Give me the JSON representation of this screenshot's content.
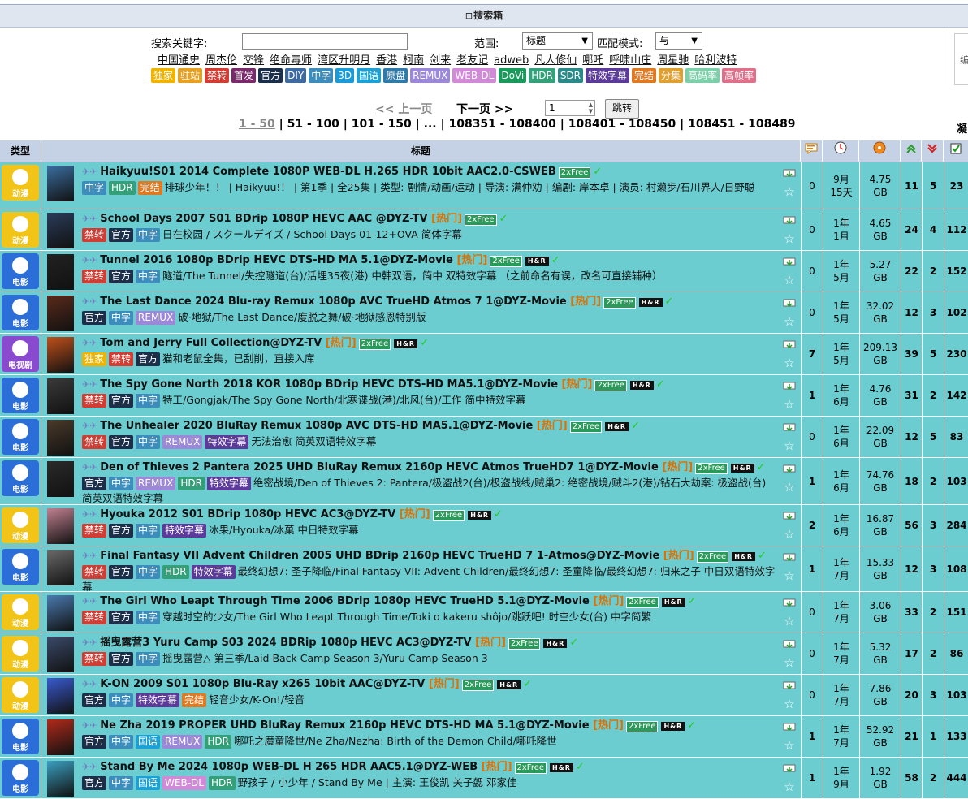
{
  "search": {
    "header": "搜索箱",
    "keyword_label": "搜索关键字:",
    "keyword_value": "",
    "scope_label": "范围:",
    "scope_value": "标题",
    "mode_label": "匹配模式:",
    "mode_value": "与",
    "quick_links": [
      "中国通史",
      "周杰伦",
      "交锋",
      "绝命毒师",
      "湾区升明月",
      "香港",
      "柯南",
      "剑来",
      "老友记",
      "adweb",
      "凡人修仙",
      "哪吒",
      "呼啸山庄",
      "周星驰",
      "哈利波特"
    ],
    "filter_tags": [
      {
        "label": "独家",
        "color": "#f0b400"
      },
      {
        "label": "驻站",
        "color": "#e8a020"
      },
      {
        "label": "禁转",
        "color": "#d23c32"
      },
      {
        "label": "首发",
        "color": "#7a2a6a"
      },
      {
        "label": "官方",
        "color": "#1c2f4a"
      },
      {
        "label": "DIY",
        "color": "#3d6aa0"
      },
      {
        "label": "中字",
        "color": "#3c8dbc"
      },
      {
        "label": "3D",
        "color": "#1a9ad6"
      },
      {
        "label": "国语",
        "color": "#1aa2d8"
      },
      {
        "label": "原盘",
        "color": "#2f7aa8"
      },
      {
        "label": "REMUX",
        "color": "#9c88d8"
      },
      {
        "label": "WEB-DL",
        "color": "#d28ad8"
      },
      {
        "label": "DoVi",
        "color": "#1a9a5a"
      },
      {
        "label": "HDR",
        "color": "#34a07a"
      },
      {
        "label": "SDR",
        "color": "#2a8a8a"
      },
      {
        "label": "特效字幕",
        "color": "#5b3a9a"
      },
      {
        "label": "完结",
        "color": "#e07a22"
      },
      {
        "label": "分集",
        "color": "#e0a030"
      },
      {
        "label": "高码率",
        "color": "#7ccfa8"
      },
      {
        "label": "高帧率",
        "color": "#e0708a"
      }
    ],
    "side_text": "编"
  },
  "pager": {
    "prev": "<< 上一页",
    "next": "下一页 >>",
    "page_value": "1",
    "jump": "跳转",
    "current": "1 - 50",
    "ranges_text": " | 51 - 100 | 101 - 150 | ... | 108351 - 108400 | 108401 - 108450 | 108451 - 108489",
    "side": "凝"
  },
  "table": {
    "col_type": "类型",
    "col_title": "标题",
    "icons": {
      "comments": "comment-icon",
      "time": "clock-icon",
      "size": "disc-icon",
      "seeders": "up-arrows-icon",
      "leechers": "down-arrows-icon",
      "completed": "check-icon"
    },
    "rows": [
      {
        "cat": "动漫",
        "catcolor": "#f2c418",
        "poster": "#3a6ea0",
        "title": "Haikyuu!S01 2014 Complete 1080P WEB-DL H.265 HDR 10bit AAC2.0-CSWEB",
        "hot": "",
        "hr": false,
        "tags": [
          "中字",
          "HDR",
          "完结"
        ],
        "sub": "排球少年！！ | Haikyuu!！ | 第1季 | 全25集 | 类型: 剧情/动画/运动 | 导演: 满仲劝 | 编剧: 岸本卓 | 演员: 村濑步/石川界人/日野聪",
        "comments": "0",
        "time1": "9月",
        "time2": "15天",
        "size1": "4.75",
        "size2": "GB",
        "seed": "11",
        "leech": "5",
        "done": "23",
        "h": 58,
        "boldc": false
      },
      {
        "cat": "动漫",
        "catcolor": "#f2c418",
        "poster": "#2a3c5a",
        "title": "School Days 2007 S01 BDrip 1080P HEVC AAC @DYZ-TV",
        "hot": "[热门]",
        "hr": false,
        "tags": [
          "禁转",
          "官方",
          "中字"
        ],
        "sub": "日在校园 / スクールデイズ / School Days 01-12+OVA 简体字幕",
        "comments": "0",
        "time1": "1年",
        "time2": "1月",
        "size1": "4.65",
        "size2": "GB",
        "seed": "24",
        "leech": "4",
        "done": "112",
        "h": 51,
        "boldc": false
      },
      {
        "cat": "电影",
        "catcolor": "#2b6ed8",
        "poster": "#222",
        "title": "Tunnel 2016 1080p BDrip HEVC DTS-HD MA 5.1@DYZ-Movie",
        "hot": "[热门]",
        "hr": true,
        "tags": [
          "禁转",
          "官方",
          "中字"
        ],
        "sub": "隧道/The Tunnel/失控隧道(台)/活埋35夜(港) 中韩双语，简中 双特效字幕 （之前命名有误，改名可直接辅种）",
        "comments": "0",
        "time1": "1年",
        "time2": "5月",
        "size1": "5.27",
        "size2": "GB",
        "seed": "22",
        "leech": "2",
        "done": "152",
        "h": 51,
        "boldc": false
      },
      {
        "cat": "电影",
        "catcolor": "#2b6ed8",
        "poster": "#5a2a1a",
        "title": "The Last Dance 2024 Blu-ray Remux 1080p AVC TrueHD Atmos 7 1@DYZ-Movie",
        "hot": "[热门]",
        "hr": true,
        "tags": [
          "官方",
          "中字",
          "REMUX"
        ],
        "sub": "破·地狱/The Last Dance/度脱之舞/破·地狱感恩特别版",
        "comments": "0",
        "time1": "1年",
        "time2": "5月",
        "size1": "32.02",
        "size2": "GB",
        "seed": "12",
        "leech": "3",
        "done": "102",
        "h": 51,
        "boldc": false
      },
      {
        "cat": "电视剧",
        "catcolor": "#8a4ad0",
        "poster": "#c0501a",
        "title": "Tom and Jerry Full Collection@DYZ-TV",
        "hot": "[热门]",
        "hr": true,
        "tags": [
          "独家",
          "禁转",
          "官方"
        ],
        "sub": "猫和老鼠全集，已刮削，直接入库",
        "comments": "7",
        "time1": "1年",
        "time2": "5月",
        "size1": "209.13",
        "size2": "GB",
        "seed": "39",
        "leech": "5",
        "done": "230",
        "h": 51,
        "boldc": true
      },
      {
        "cat": "电影",
        "catcolor": "#2b6ed8",
        "poster": "#3a3a3a",
        "title": "The Spy Gone North 2018 KOR 1080p BDrip HEVC DTS-HD MA5.1@DYZ-Movie",
        "hot": "[热门]",
        "hr": true,
        "tags": [
          "禁转",
          "官方",
          "中字"
        ],
        "sub": "特工/Gongjak/The Spy Gone North/北寒谍战(港)/北风(台)/工作 简中特效字幕",
        "comments": "1",
        "time1": "1年",
        "time2": "6月",
        "size1": "4.76",
        "size2": "GB",
        "seed": "31",
        "leech": "2",
        "done": "142",
        "h": 51,
        "boldc": true
      },
      {
        "cat": "电影",
        "catcolor": "#2b6ed8",
        "poster": "#4a3a2a",
        "title": "The Unhealer 2020 BluRay Remux 1080p AVC DTS-HD MA5.1@DYZ-Movie",
        "hot": "[热门]",
        "hr": true,
        "tags": [
          "禁转",
          "官方",
          "中字",
          "REMUX",
          "特效字幕"
        ],
        "sub": "无法治愈 简英双语特效字幕",
        "comments": "0",
        "time1": "1年",
        "time2": "6月",
        "size1": "22.09",
        "size2": "GB",
        "seed": "12",
        "leech": "5",
        "done": "83",
        "h": 51,
        "boldc": false
      },
      {
        "cat": "电影",
        "catcolor": "#2b6ed8",
        "poster": "#2a2a2a",
        "title": "Den of Thieves 2 Pantera 2025 UHD BluRay Remux 2160p HEVC Atmos TrueHD7 1@DYZ-Movie",
        "hot": "[热门]",
        "hr": true,
        "tags": [
          "官方",
          "中字",
          "REMUX",
          "HDR",
          "特效字幕"
        ],
        "sub": "绝密战境/Den of Thieves 2: Pantera/极盗战2(台)/极盗战线/贼巢2: 绝密战境/贼斗2(港)/钻石大劫案: 极盗战(台) 简英双语特效字幕",
        "comments": "1",
        "time1": "1年",
        "time2": "6月",
        "size1": "74.76",
        "size2": "GB",
        "seed": "18",
        "leech": "2",
        "done": "103",
        "h": 58,
        "boldc": true
      },
      {
        "cat": "动漫",
        "catcolor": "#f2c418",
        "poster": "#c08090",
        "title": "Hyouka 2012 S01 BDrip 1080p HEVC AC3@DYZ-TV",
        "hot": "[热门]",
        "hr": true,
        "tags": [
          "禁转",
          "官方",
          "中字",
          "特效字幕"
        ],
        "sub": "冰果/Hyouka/冰菓 中日特效字幕",
        "comments": "2",
        "time1": "1年",
        "time2": "6月",
        "size1": "16.87",
        "size2": "GB",
        "seed": "56",
        "leech": "3",
        "done": "284",
        "h": 51,
        "boldc": true
      },
      {
        "cat": "电影",
        "catcolor": "#2b6ed8",
        "poster": "#6a6a6a",
        "title": "Final Fantasy VII Advent Children 2005 UHD BDrip 2160p HEVC TrueHD 7 1-Atmos@DYZ-Movie",
        "hot": "[热门]",
        "hr": true,
        "tags": [
          "禁转",
          "官方",
          "中字",
          "HDR",
          "特效字幕"
        ],
        "sub": "最终幻想7: 圣子降临/Final Fantasy VII: Advent Children/最终幻想7: 圣童降临/最终幻想7: 归来之子 中日双语特效字幕",
        "comments": "1",
        "time1": "1年",
        "time2": "7月",
        "size1": "15.33",
        "size2": "GB",
        "seed": "12",
        "leech": "3",
        "done": "108",
        "h": 56,
        "boldc": true
      },
      {
        "cat": "动漫",
        "catcolor": "#f2c418",
        "poster": "#4a7ab0",
        "title": "The Girl Who Leapt Through Time 2006 BDrip 1080p HEVC TrueHD 5.1@DYZ-Movie",
        "hot": "[热门]",
        "hr": true,
        "tags": [
          "禁转",
          "官方",
          "中字"
        ],
        "sub": "穿越时空的少女/The Girl Who Leapt Through Time/Toki o kakeru shôjo/跳跃吧! 时空少女(台) 中字简繁",
        "comments": "0",
        "time1": "1年",
        "time2": "7月",
        "size1": "3.06",
        "size2": "GB",
        "seed": "33",
        "leech": "2",
        "done": "151",
        "h": 51,
        "boldc": false
      },
      {
        "cat": "动漫",
        "catcolor": "#f2c418",
        "poster": "#3a4a6a",
        "title": "摇曳露营3 Yuru Camp S03 2024 BDRip 1080p HEVC AC3@DYZ-TV",
        "hot": "[热门]",
        "hr": true,
        "tags": [
          "禁转",
          "官方",
          "中字"
        ],
        "sub": "摇曳露营△ 第三季/Laid-Back Camp Season 3/Yuru Camp Season 3",
        "comments": "0",
        "time1": "1年",
        "time2": "7月",
        "size1": "5.32",
        "size2": "GB",
        "seed": "17",
        "leech": "2",
        "done": "86",
        "h": 51,
        "boldc": false
      },
      {
        "cat": "动漫",
        "catcolor": "#f2c418",
        "poster": "#3a5ad0",
        "title": "K-ON 2009 S01 1080p Blu-Ray x265 10bit AAC@DYZ-TV",
        "hot": "[热门]",
        "hr": true,
        "tags": [
          "官方",
          "中字",
          "特效字幕",
          "完结"
        ],
        "sub": "轻音少女/K-On!/轻音",
        "comments": "0",
        "time1": "1年",
        "time2": "7月",
        "size1": "7.86",
        "size2": "GB",
        "seed": "20",
        "leech": "3",
        "done": "103",
        "h": 51,
        "boldc": false
      },
      {
        "cat": "电影",
        "catcolor": "#2b6ed8",
        "poster": "#b02a1a",
        "title": "Ne Zha 2019 PROPER UHD BluRay Remux 2160p HEVC DTS-HD MA 5.1@DYZ-Movie",
        "hot": "[热门]",
        "hr": true,
        "tags": [
          "官方",
          "中字",
          "国语",
          "REMUX",
          "HDR"
        ],
        "sub": "哪吒之魔童降世/Ne Zha/Nezha: Birth of the Demon Child/哪吒降世",
        "comments": "1",
        "time1": "1年",
        "time2": "7月",
        "size1": "52.92",
        "size2": "GB",
        "seed": "21",
        "leech": "1",
        "done": "133",
        "h": 51,
        "boldc": true
      },
      {
        "cat": "电影",
        "catcolor": "#2b6ed8",
        "poster": "#3aa0c0",
        "title": "Stand By Me 2024 1080p WEB-DL H 265 HDR AAC5.1@DYZ-WEB",
        "hot": "[热门]",
        "hr": true,
        "tags": [
          "官方",
          "中字",
          "国语",
          "WEB-DL",
          "HDR"
        ],
        "sub": "野孩子 / 小少年 / Stand By Me | 主演: 王俊凯 关子勰 邓家佳",
        "comments": "1",
        "time1": "1年",
        "time2": "9月",
        "size1": "1.92",
        "size2": "GB",
        "seed": "58",
        "leech": "2",
        "done": "444",
        "h": 51,
        "boldc": true
      }
    ]
  }
}
